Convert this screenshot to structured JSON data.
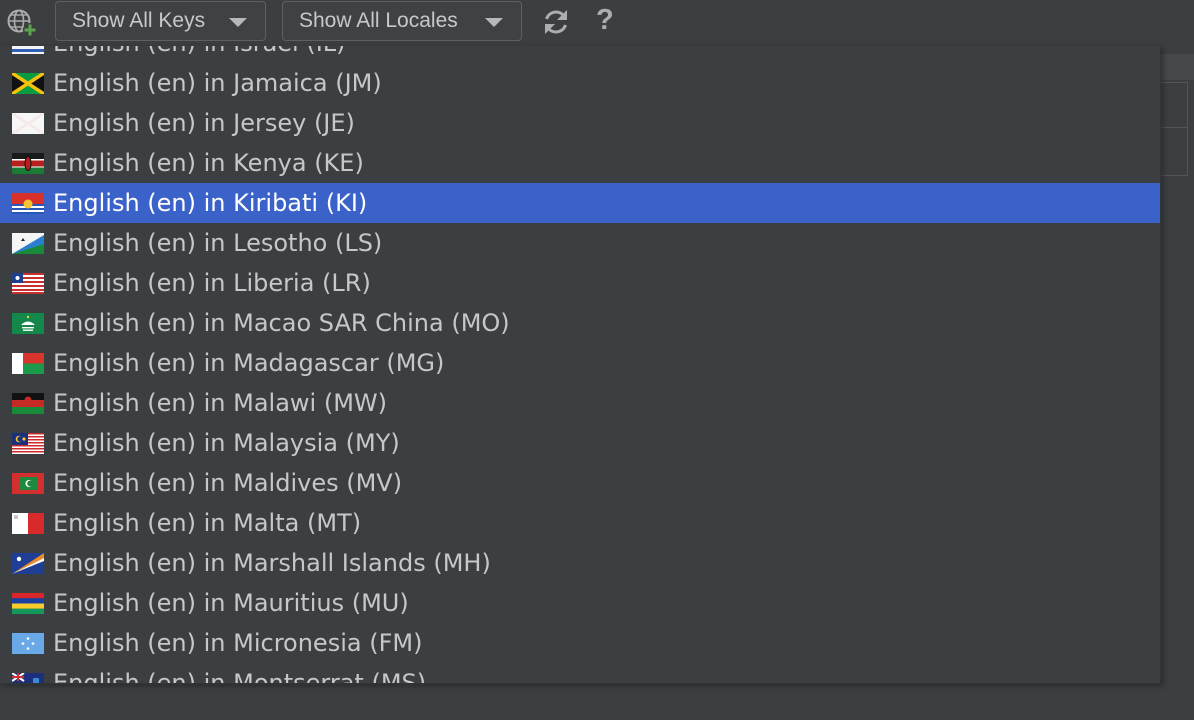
{
  "toolbar": {
    "add_locale_icon": "globe-plus-icon",
    "keys_filter": {
      "label": "Show All Keys",
      "icon": "chevron-down-icon"
    },
    "locales_filter": {
      "label": "Show All Locales",
      "icon": "chevron-down-icon"
    },
    "reload_icon": "refresh-icon",
    "help_label": "?"
  },
  "colors": {
    "background": "#3c3f41",
    "selection": "#3b62c8",
    "text": "#c7c7c7",
    "selected_text": "#ffffff"
  },
  "locale_list": {
    "selected_index": 4,
    "items": [
      {
        "label": "English (en) in Israel (IL)",
        "flag": "IL"
      },
      {
        "label": "English (en) in Jamaica (JM)",
        "flag": "JM"
      },
      {
        "label": "English (en) in Jersey (JE)",
        "flag": "JE"
      },
      {
        "label": "English (en) in Kenya (KE)",
        "flag": "KE"
      },
      {
        "label": "English (en) in Kiribati (KI)",
        "flag": "KI"
      },
      {
        "label": "English (en) in Lesotho (LS)",
        "flag": "LS"
      },
      {
        "label": "English (en) in Liberia (LR)",
        "flag": "LR"
      },
      {
        "label": "English (en) in Macao SAR China (MO)",
        "flag": "MO"
      },
      {
        "label": "English (en) in Madagascar (MG)",
        "flag": "MG"
      },
      {
        "label": "English (en) in Malawi (MW)",
        "flag": "MW"
      },
      {
        "label": "English (en) in Malaysia (MY)",
        "flag": "MY"
      },
      {
        "label": "English (en) in Maldives (MV)",
        "flag": "MV"
      },
      {
        "label": "English (en) in Malta (MT)",
        "flag": "MT"
      },
      {
        "label": "English (en) in Marshall Islands (MH)",
        "flag": "MH"
      },
      {
        "label": "English (en) in Mauritius (MU)",
        "flag": "MU"
      },
      {
        "label": "English (en) in Micronesia (FM)",
        "flag": "FM"
      },
      {
        "label": "English (en) in Montserrat (MS)",
        "flag": "MS"
      }
    ]
  }
}
